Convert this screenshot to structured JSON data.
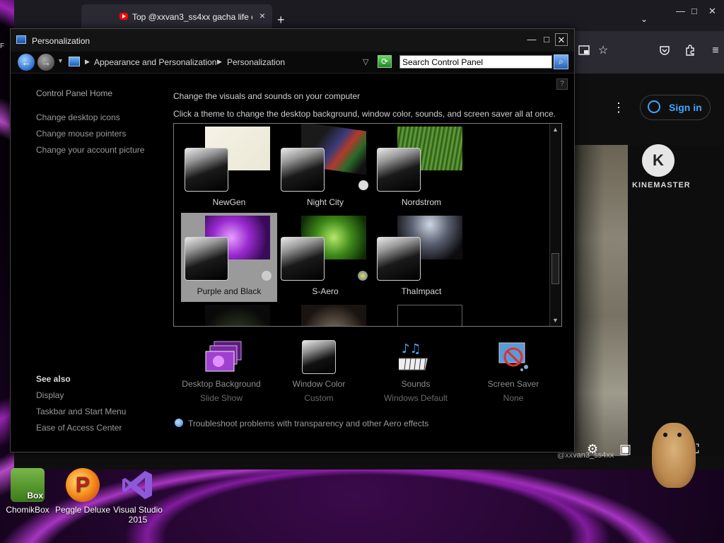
{
  "browser": {
    "tab_title": "Top @xxvan3_ss4xx gacha life c",
    "tab_close": "×",
    "new_tab": "+",
    "tab_list": "⌄",
    "minimize": "—",
    "maximize": "□",
    "close": "✕",
    "sign_in_label": "Sign in",
    "kebab": "⋮",
    "kinemaster_logo_letter": "K",
    "kinemaster_label": "KINEMASTER",
    "tiktok_user": "@xxvan3_ss4xx",
    "toolbar_icons": [
      "picture-in-picture-icon",
      "star-icon",
      "pocket-icon",
      "extensions-icon",
      "menu-icon"
    ]
  },
  "window": {
    "title": "Personalization",
    "minimize": "—",
    "maximize": "□",
    "close": "✕"
  },
  "addressbar": {
    "crumb_1": "Appearance and Personalization",
    "crumb_2": "Personalization",
    "search_placeholder": "Search Control Panel"
  },
  "sidebar": {
    "home": "Control Panel Home",
    "links": [
      "Change desktop icons",
      "Change mouse pointers",
      "Change your account picture"
    ],
    "see_also_heading": "See also",
    "see_also": [
      "Display",
      "Taskbar and Start Menu",
      "Ease of Access Center"
    ]
  },
  "main": {
    "heading": "Change the visuals and sounds on your computer",
    "subheading": "Click a theme to change the desktop background, window color, sounds, and screen saver all at once."
  },
  "themes": [
    {
      "name": "NewGen",
      "selected": false
    },
    {
      "name": "Night City",
      "selected": false
    },
    {
      "name": "Nordstrom",
      "selected": false
    },
    {
      "name": "Purple and Black",
      "selected": true
    },
    {
      "name": "S-Aero",
      "selected": false
    },
    {
      "name": "ThaImpact",
      "selected": false
    }
  ],
  "bottom": [
    {
      "label": "Desktop Background",
      "value": "Slide Show",
      "icon": "desktop-background-icon"
    },
    {
      "label": "Window Color",
      "value": "Custom",
      "icon": "window-color-icon"
    },
    {
      "label": "Sounds",
      "value": "Windows Default",
      "icon": "sounds-icon"
    },
    {
      "label": "Screen Saver",
      "value": "None",
      "icon": "screen-saver-icon"
    }
  ],
  "troubleshoot": "Troubleshoot problems with transparency and other Aero effects",
  "desktop_icons": [
    {
      "label": "ChomikBox"
    },
    {
      "label": "Peggle Deluxe"
    },
    {
      "label": "Visual Studio 2015"
    }
  ],
  "colors": {
    "accent_link": "#3ea6ff",
    "desktop_purple": "#8c1eaa",
    "selected_theme": "#9a9a9a"
  }
}
